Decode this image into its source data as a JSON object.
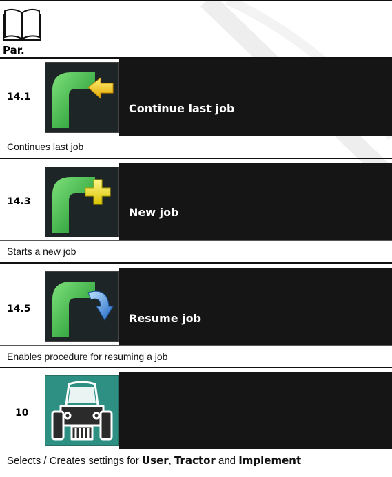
{
  "header": {
    "par_label": "Par."
  },
  "rows": [
    {
      "par": "14.1",
      "icon": "continue-last-job-icon",
      "label": "Continue last job",
      "description": "Continues last job"
    },
    {
      "par": "14.3",
      "icon": "new-job-icon",
      "label": "New job",
      "description": "Starts a new job"
    },
    {
      "par": "14.5",
      "icon": "resume-job-icon",
      "label": "Resume job",
      "description": "Enables procedure for resuming a job"
    },
    {
      "par": "10",
      "icon": "tractor-icon",
      "label": "",
      "description_parts": [
        "Selects / Creates settings for ",
        "User",
        ", ",
        "Tractor",
        " and ",
        "Implement"
      ]
    }
  ],
  "colors": {
    "dark_bar": "#151515",
    "icon_bg": "#1d2526",
    "tractor_bg": "#2e8f83",
    "green": "#39c24a",
    "yellow": "#f2d21c",
    "blue": "#2f7fd6"
  }
}
